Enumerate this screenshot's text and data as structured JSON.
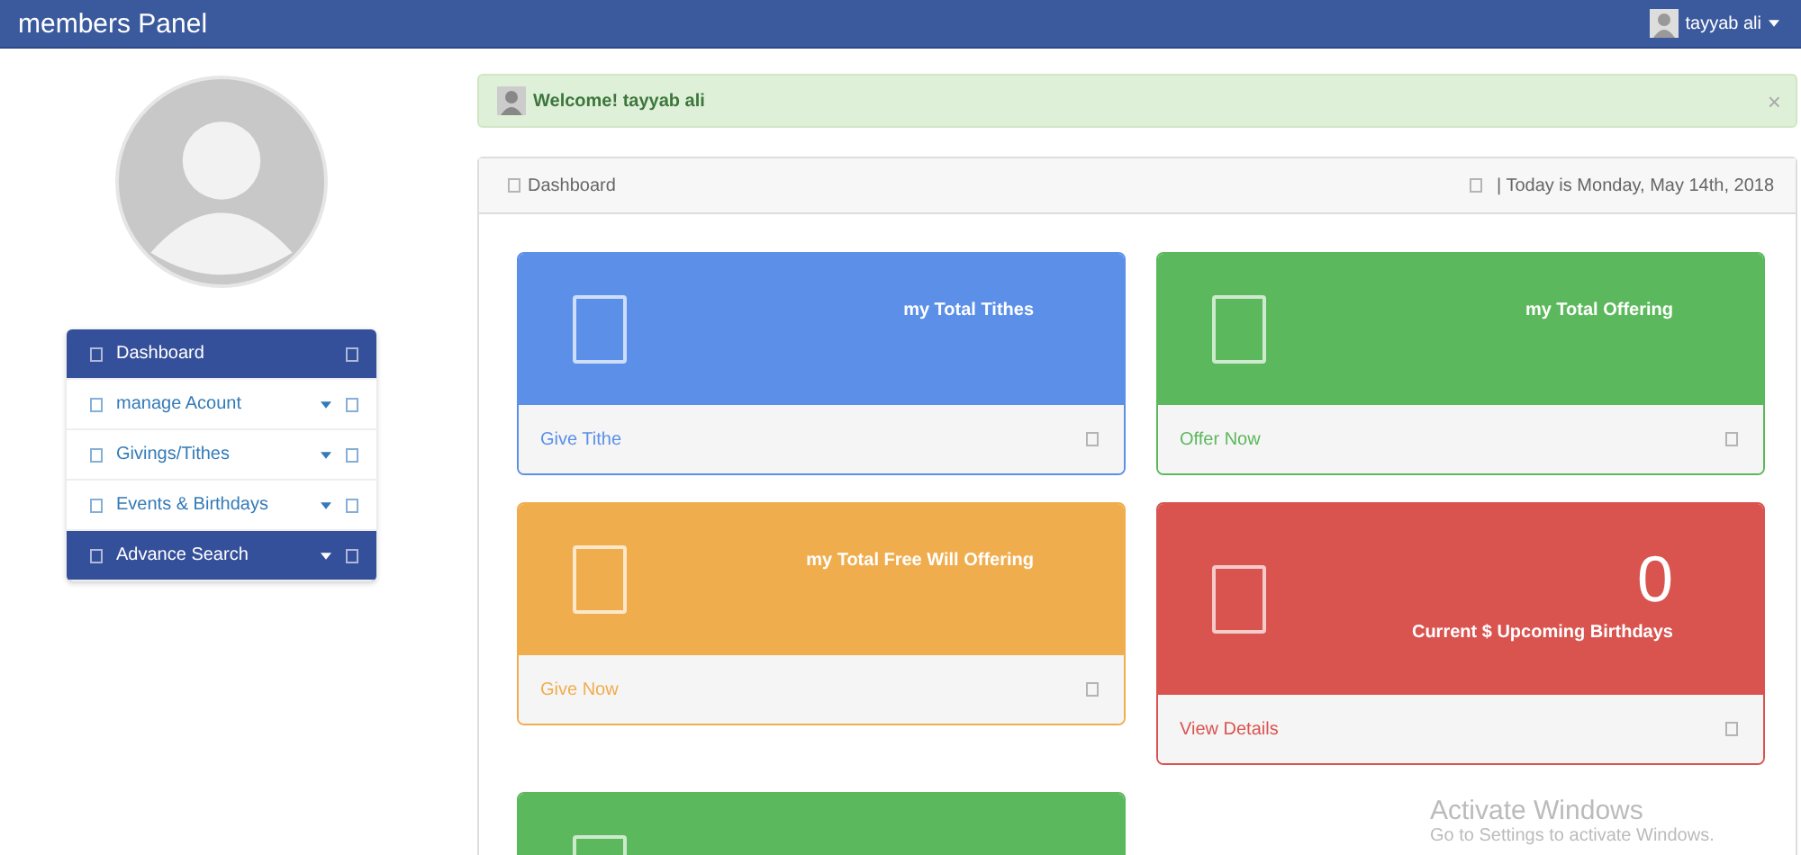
{
  "navbar": {
    "brand": "members Panel",
    "user": "tayyab ali"
  },
  "sidebar": {
    "items": [
      {
        "label": "Dashboard",
        "selected": true,
        "has_caret": false
      },
      {
        "label": "manage Acount",
        "selected": false,
        "has_caret": true
      },
      {
        "label": "Givings/Tithes",
        "selected": false,
        "has_caret": true
      },
      {
        "label": "Events & Birthdays",
        "selected": false,
        "has_caret": true
      },
      {
        "label": "Advance Search",
        "selected": true,
        "has_caret": true
      }
    ]
  },
  "alert": {
    "message": "Welcome! tayyab ali",
    "close": "×"
  },
  "panel": {
    "title": "Dashboard",
    "date": "| Today is Monday, May 14th, 2018"
  },
  "cards": [
    {
      "title": "my Total Tithes",
      "link": "Give Tithe",
      "color": "#5b8fe8"
    },
    {
      "title": "my Total Offering",
      "link": "Offer Now",
      "color": "#5cb85c"
    },
    {
      "title": "my Total Free Will Offering",
      "link": "Give Now",
      "color": "#f0ad4e"
    },
    {
      "value": "0",
      "title": "Current $ Upcoming Birthdays",
      "link": "View Details",
      "color": "#d9534f"
    },
    {
      "color": "#5cb85c"
    }
  ],
  "os_overlay": {
    "title": "Activate Windows",
    "subtitle": "Go to Settings to activate Windows."
  }
}
